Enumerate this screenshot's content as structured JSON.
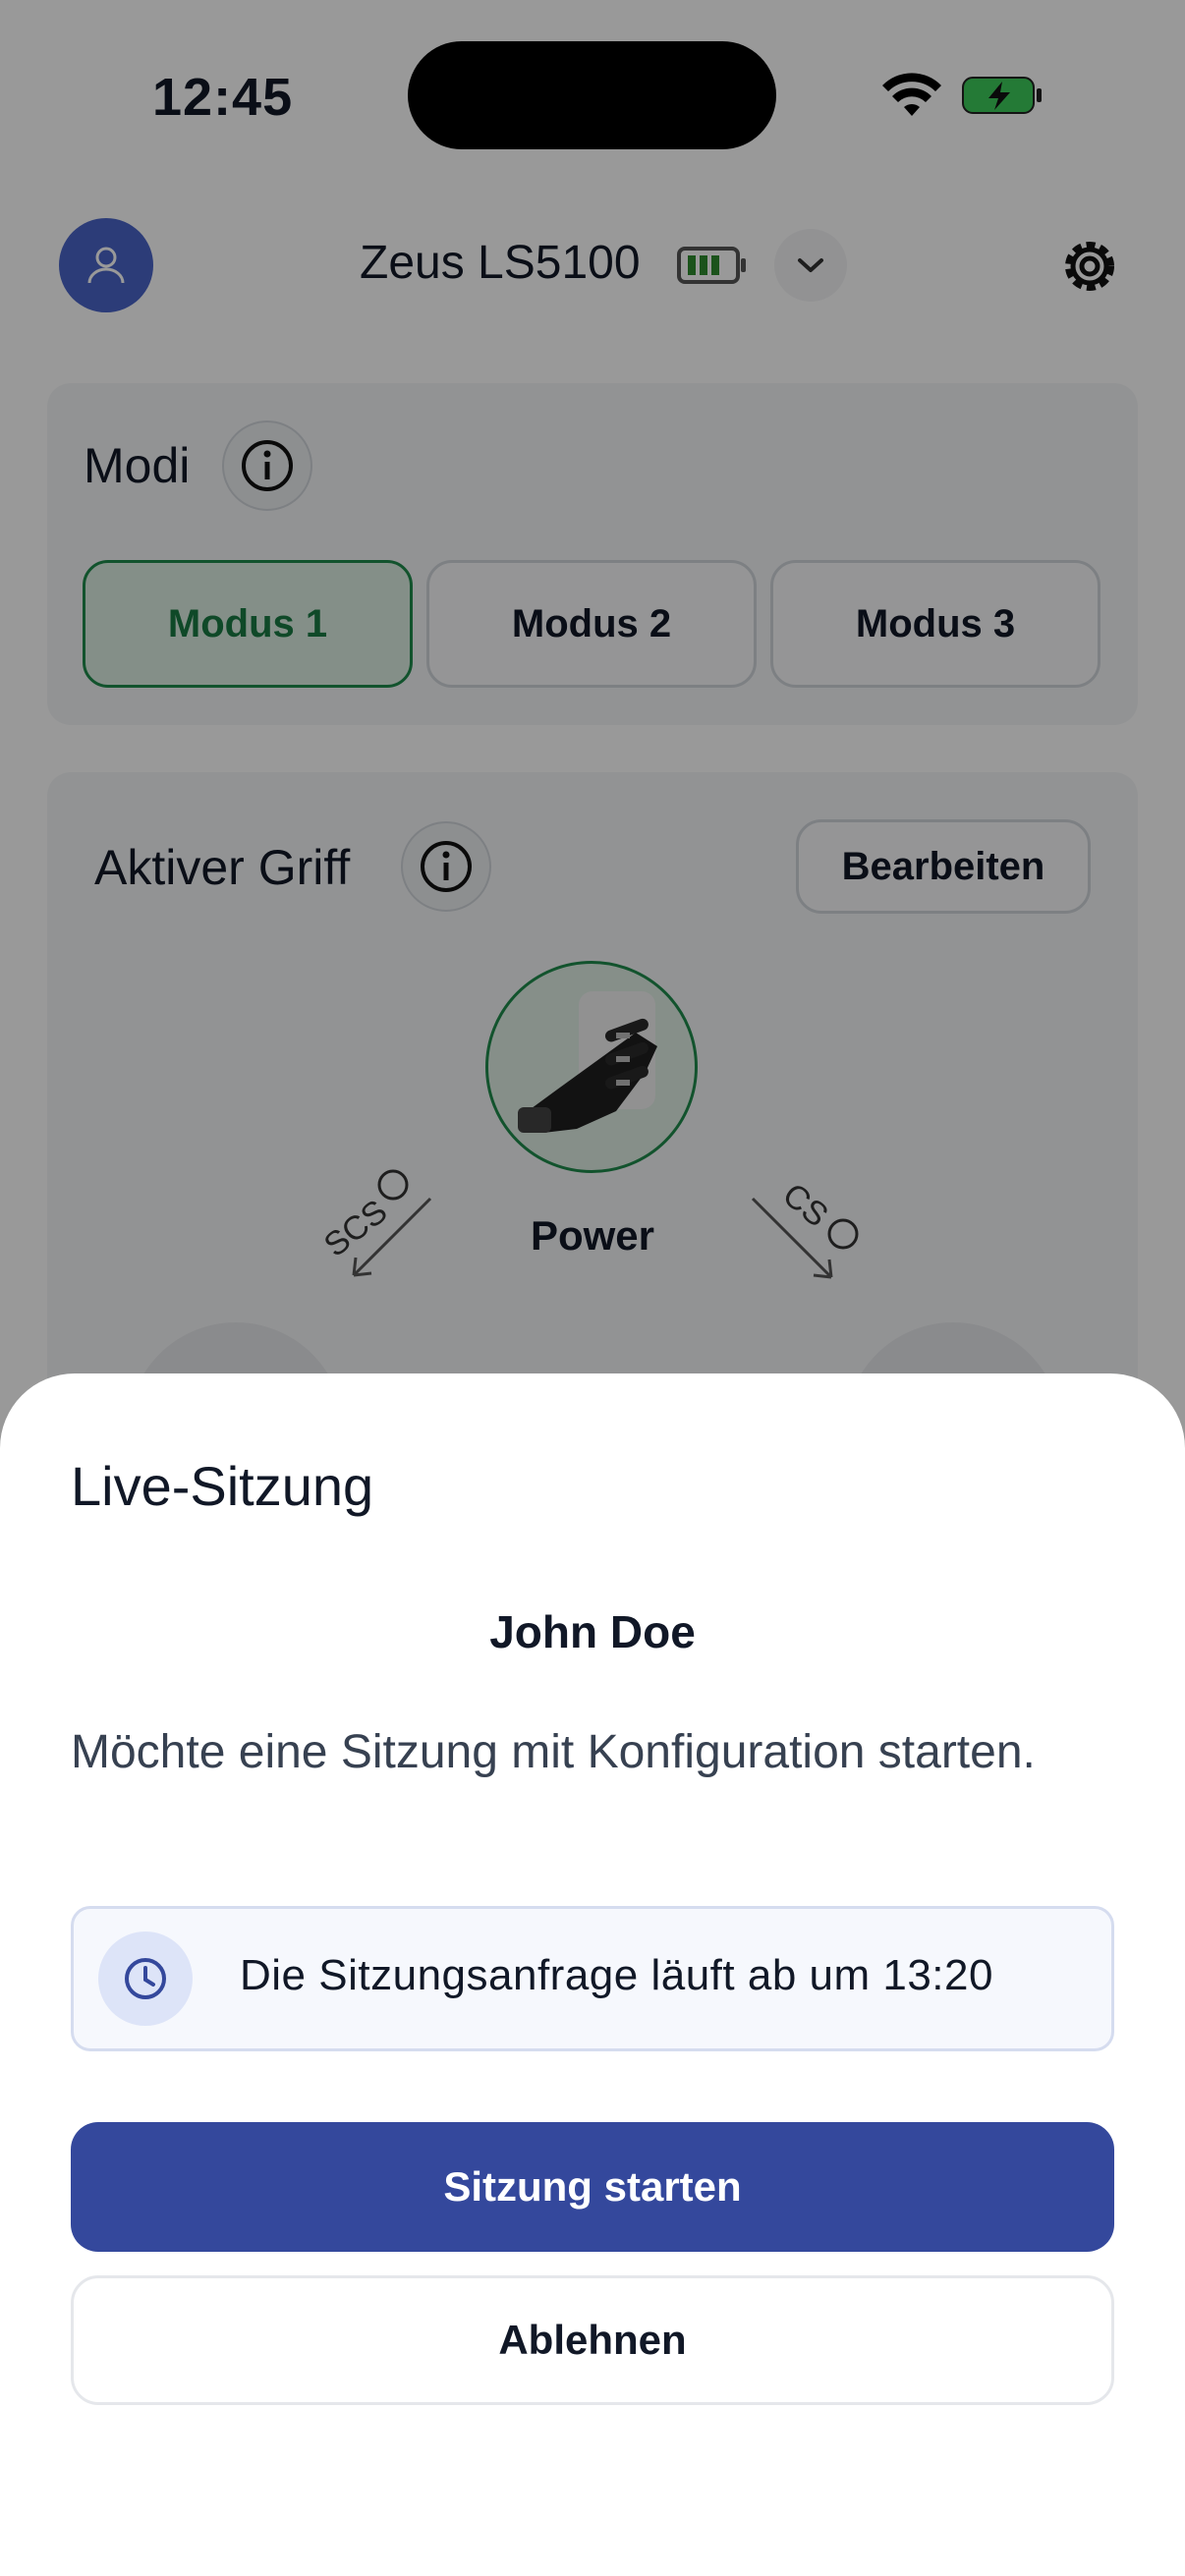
{
  "status_bar": {
    "time": "12:45",
    "icons": [
      "wifi-icon",
      "battery-charging-icon"
    ]
  },
  "header": {
    "device_name": "Zeus LS5100",
    "icons": [
      "user-icon",
      "device-battery-icon",
      "chevron-down-icon",
      "gear-icon"
    ]
  },
  "modes": {
    "title": "Modi",
    "items": [
      {
        "label": "Modus 1",
        "active": true
      },
      {
        "label": "Modus 2",
        "active": false
      },
      {
        "label": "Modus 3",
        "active": false
      }
    ]
  },
  "active_grip": {
    "title": "Aktiver Griff",
    "edit_label": "Bearbeiten",
    "grip_name": "Power",
    "left_trigger": "SCS",
    "right_trigger": "CS"
  },
  "sheet": {
    "title": "Live-Sitzung",
    "requester": "John Doe",
    "message": "Möchte eine Sitzung mit Konfiguration starten.",
    "expiry": "Die Sitzungsanfrage läuft ab um 13:20",
    "primary_label": "Sitzung starten",
    "secondary_label": "Ablehnen"
  },
  "colors": {
    "primary": "#34489c",
    "active_green": "#1f8a4c",
    "avatar": "#4a64c8",
    "overlay": "rgba(0,0,0,0.40)"
  }
}
